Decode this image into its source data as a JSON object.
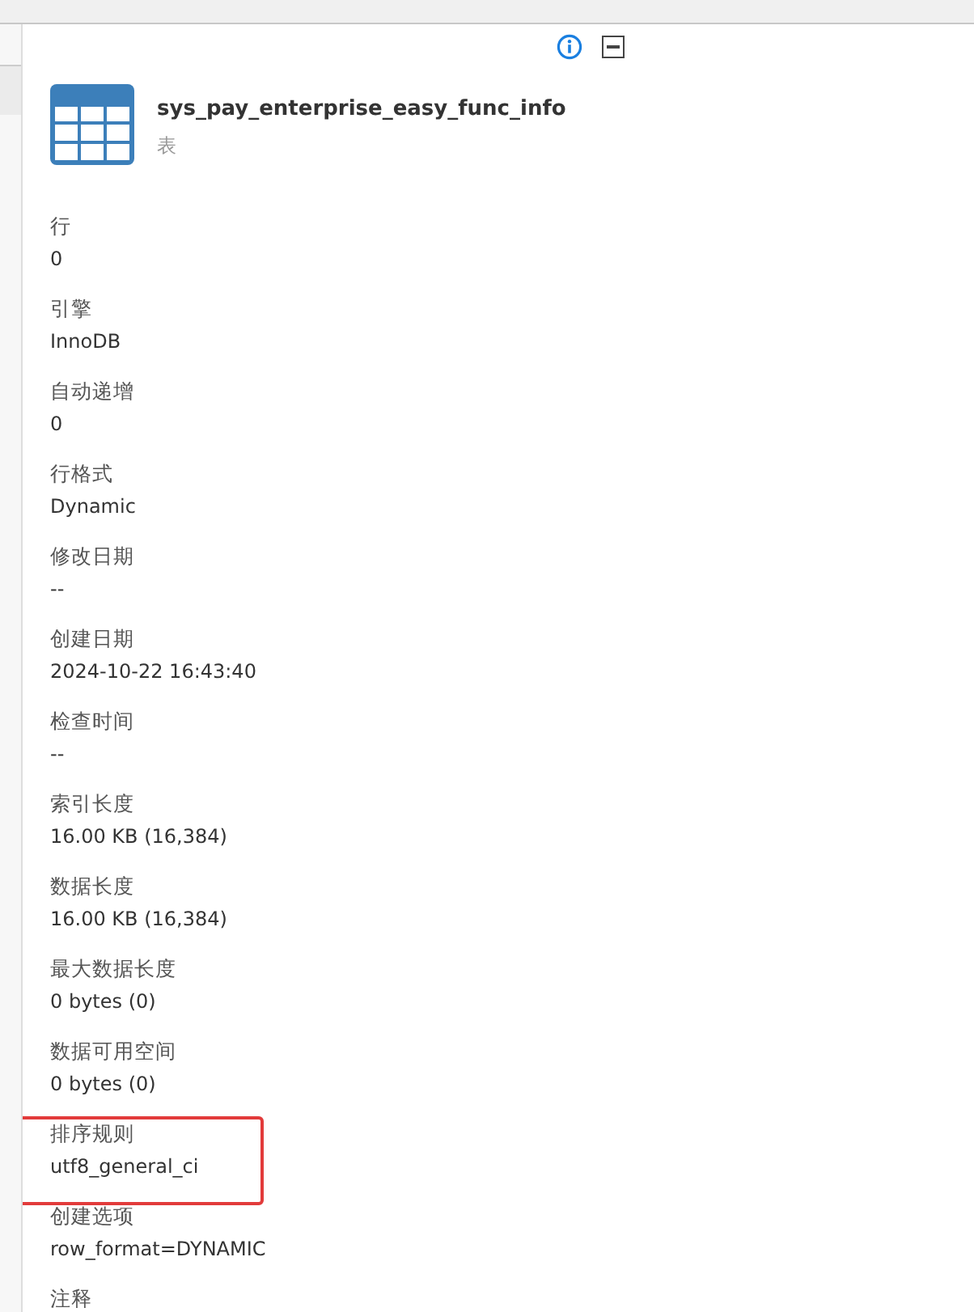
{
  "object": {
    "name": "sys_pay_enterprise_easy_func_info",
    "type": "表"
  },
  "properties": [
    {
      "label": "行",
      "value": "0",
      "highlighted": false
    },
    {
      "label": "引擎",
      "value": "InnoDB",
      "highlighted": false
    },
    {
      "label": "自动递增",
      "value": "0",
      "highlighted": false
    },
    {
      "label": "行格式",
      "value": "Dynamic",
      "highlighted": false
    },
    {
      "label": "修改日期",
      "value": "--",
      "highlighted": false
    },
    {
      "label": "创建日期",
      "value": "2024-10-22 16:43:40",
      "highlighted": false
    },
    {
      "label": "检查时间",
      "value": "--",
      "highlighted": false
    },
    {
      "label": "索引长度",
      "value": "16.00 KB (16,384)",
      "highlighted": false
    },
    {
      "label": "数据长度",
      "value": "16.00 KB (16,384)",
      "highlighted": false
    },
    {
      "label": "最大数据长度",
      "value": "0 bytes (0)",
      "highlighted": false
    },
    {
      "label": "数据可用空间",
      "value": "0 bytes (0)",
      "highlighted": false
    },
    {
      "label": "排序规则",
      "value": "utf8_general_ci",
      "highlighted": true
    },
    {
      "label": "创建选项",
      "value": "row_format=DYNAMIC",
      "highlighted": false
    },
    {
      "label": "注释",
      "highlighted": false
    }
  ]
}
